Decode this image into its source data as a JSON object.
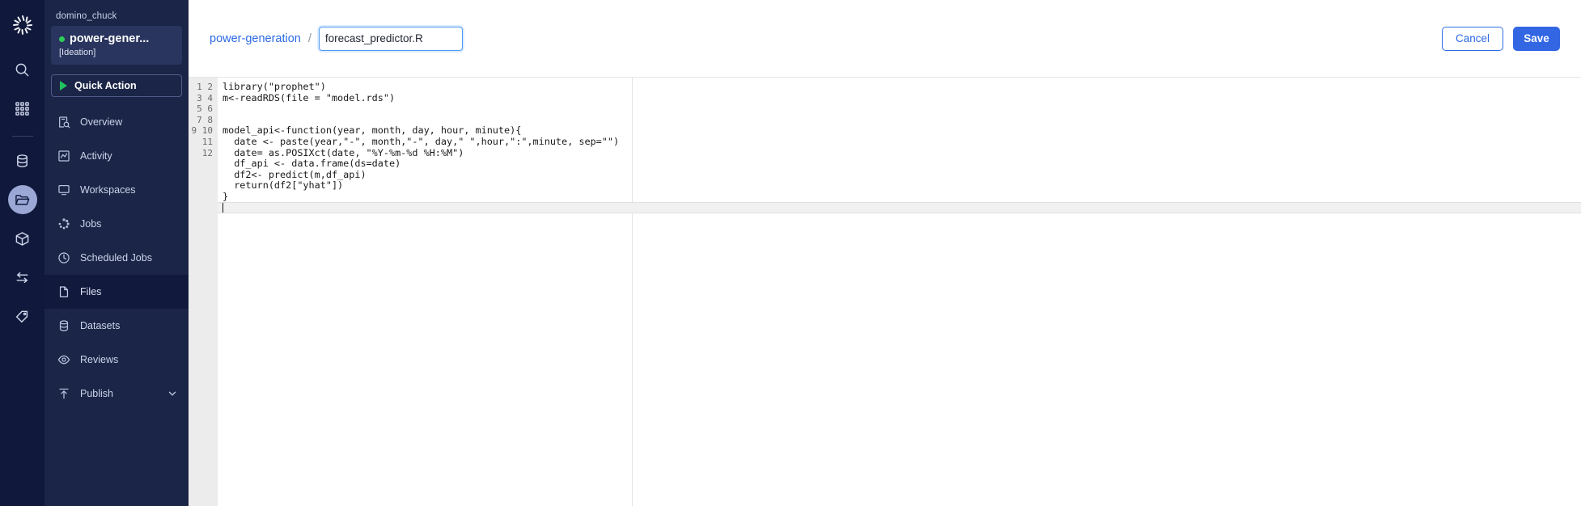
{
  "rail": {
    "logo_icon": "domino-logo-icon",
    "items": [
      {
        "name": "search-icon",
        "label": "Search",
        "active": false
      },
      {
        "name": "apps-grid-icon",
        "label": "Apps",
        "active": false
      },
      {
        "name": "database-icon",
        "label": "Data",
        "active": false
      },
      {
        "name": "folder-open-icon",
        "label": "Projects",
        "active": true
      },
      {
        "name": "cube-icon",
        "label": "Environments",
        "active": false
      },
      {
        "name": "transfer-arrows-icon",
        "label": "Transfers",
        "active": false
      },
      {
        "name": "tag-icon",
        "label": "Tags",
        "active": false
      }
    ]
  },
  "sidebar": {
    "org": "domino_chuck",
    "project_name": "power-gener...",
    "project_stage": "[Ideation]",
    "status_color": "#2ecc5a",
    "quick_action_label": "Quick Action",
    "items": [
      {
        "label": "Overview",
        "icon": "overview-icon",
        "selected": false,
        "chevron": false
      },
      {
        "label": "Activity",
        "icon": "activity-chart-icon",
        "selected": false,
        "chevron": false
      },
      {
        "label": "Workspaces",
        "icon": "monitor-icon",
        "selected": false,
        "chevron": false
      },
      {
        "label": "Jobs",
        "icon": "jobs-spinner-icon",
        "selected": false,
        "chevron": false
      },
      {
        "label": "Scheduled Jobs",
        "icon": "clock-icon",
        "selected": false,
        "chevron": false
      },
      {
        "label": "Files",
        "icon": "file-icon",
        "selected": true,
        "chevron": false
      },
      {
        "label": "Datasets",
        "icon": "datasets-icon",
        "selected": false,
        "chevron": false
      },
      {
        "label": "Reviews",
        "icon": "eye-icon",
        "selected": false,
        "chevron": false
      },
      {
        "label": "Publish",
        "icon": "publish-upload-icon",
        "selected": false,
        "chevron": true
      }
    ]
  },
  "topbar": {
    "breadcrumb_project": "power-generation",
    "breadcrumb_separator": "/",
    "filename_value": "forecast_predictor.R",
    "filename_placeholder": "File name",
    "cancel_label": "Cancel",
    "save_label": "Save",
    "accent_color": "#3266e3"
  },
  "editor": {
    "line_numbers": "1\n2\n3\n4\n5\n6\n7\n8\n9\n10\n11\n12",
    "code": "library(\"prophet\")\nm<-readRDS(file = \"model.rds\")\n\n\nmodel_api<-function(year, month, day, hour, minute){\n  date <- paste(year,\"-\", month,\"-\", day,\" \",hour,\":\",minute, sep=\"\")\n  date= as.POSIXct(date, \"%Y-%m-%d %H:%M\")\n  df_api <- data.frame(ds=date)\n  df2<- predict(m,df_api)\n  return(df2[\"yhat\"])\n}\n",
    "cursor_line": 12,
    "total_lines": 12
  }
}
